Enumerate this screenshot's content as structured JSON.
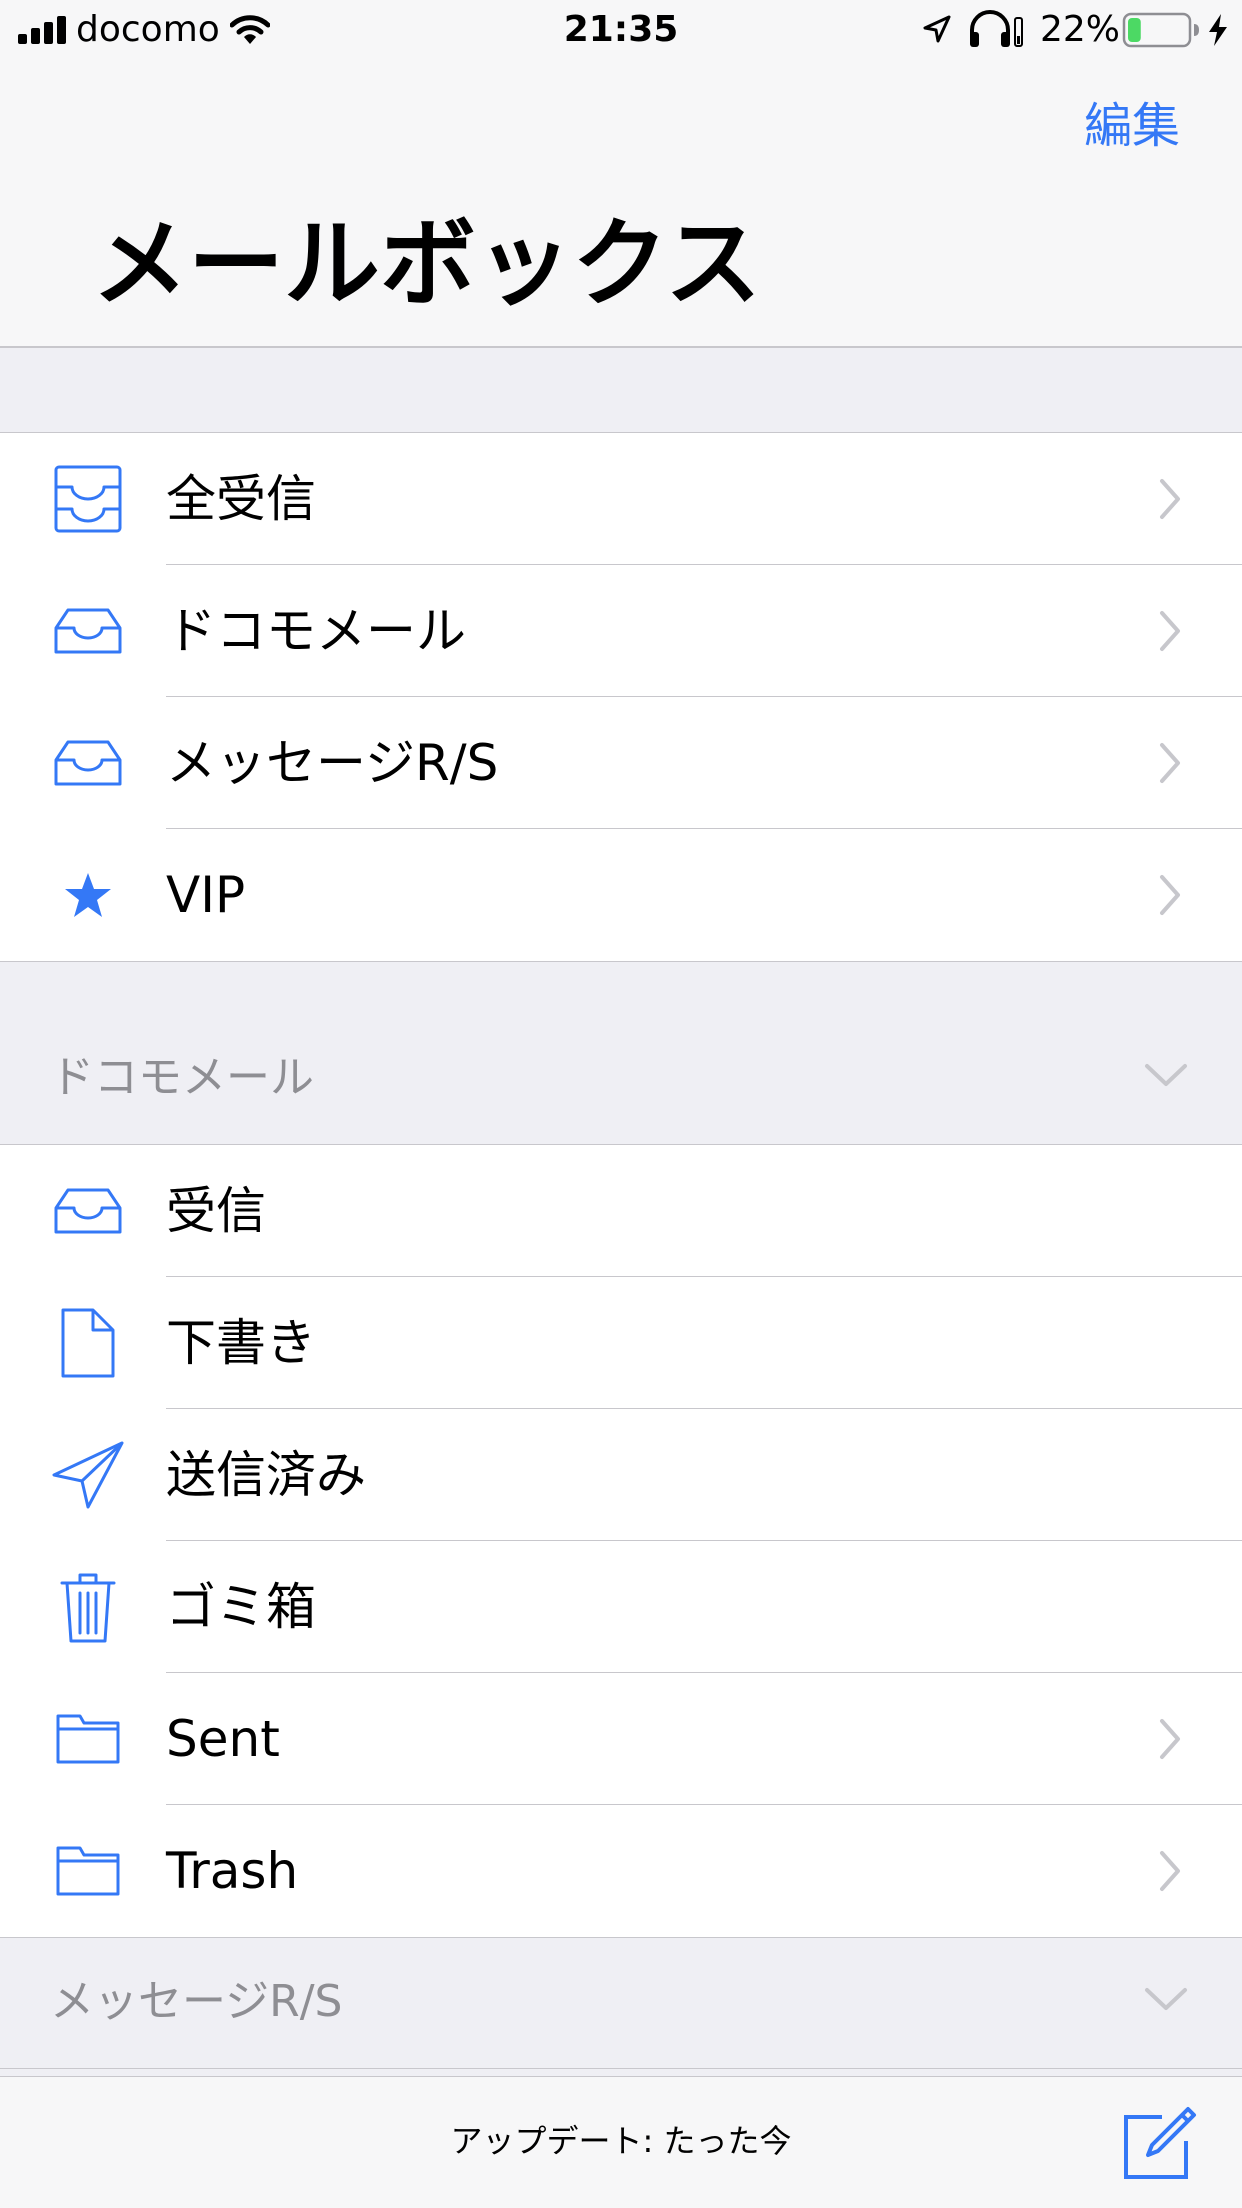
{
  "status_bar": {
    "carrier": "docomo",
    "time": "21:35",
    "battery_percent": "22%",
    "battery_level": 0.22,
    "icons": [
      "signal-icon",
      "wifi-icon",
      "location-icon",
      "headphones-icon",
      "battery-icon",
      "charging-icon"
    ]
  },
  "header": {
    "edit_label": "編集",
    "title": "メールボックス"
  },
  "mailboxes": [
    {
      "label": "全受信",
      "icon": "all-inboxes-icon",
      "chevron": true
    },
    {
      "label": "ドコモメール",
      "icon": "inbox-icon",
      "chevron": true
    },
    {
      "label": "メッセージR/S",
      "icon": "inbox-icon",
      "chevron": true
    },
    {
      "label": "VIP",
      "icon": "star-icon",
      "chevron": true
    }
  ],
  "docomo_section": {
    "title": "ドコモメール",
    "items": [
      {
        "label": "受信",
        "icon": "inbox-icon",
        "chevron": false
      },
      {
        "label": "下書き",
        "icon": "document-icon",
        "chevron": false
      },
      {
        "label": "送信済み",
        "icon": "paper-plane-icon",
        "chevron": false
      },
      {
        "label": "ゴミ箱",
        "icon": "trash-icon",
        "chevron": false
      },
      {
        "label": "Sent",
        "icon": "folder-icon",
        "chevron": true
      },
      {
        "label": "Trash",
        "icon": "folder-icon",
        "chevron": true
      }
    ]
  },
  "message_rs_section": {
    "title": "メッセージR/S"
  },
  "toolbar": {
    "update_text": "アップデート: たった今",
    "compose_icon": "compose-icon"
  },
  "colors": {
    "accent": "#3478f6",
    "battery_fill": "#4cd964",
    "secondary_text": "#8e8e93",
    "separator": "#c8c7cc",
    "grouped_background": "#efeff4"
  }
}
